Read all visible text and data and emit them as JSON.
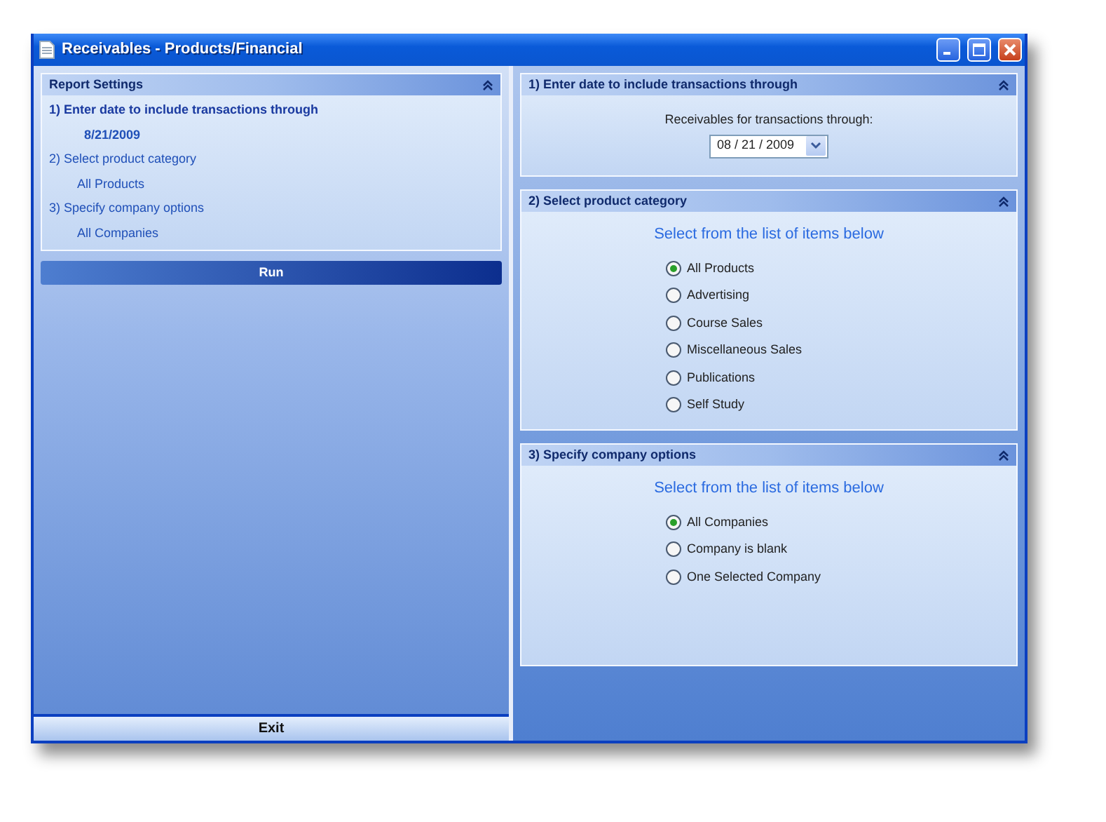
{
  "window": {
    "title": "Receivables - Products/Financial"
  },
  "summary": {
    "title": "Report Settings",
    "steps": [
      {
        "label": "1)  Enter date to include transactions through",
        "value": "8/21/2009",
        "active": true
      },
      {
        "label": "2)  Select product category",
        "value": "All Products",
        "active": false
      },
      {
        "label": "3)  Specify company options",
        "value": "All Companies",
        "active": false
      }
    ]
  },
  "run_button": "Run",
  "exit_button": "Exit",
  "sections": [
    {
      "kind": "date",
      "title": "1)  Enter date to include transactions through",
      "label": "Receivables for transactions through:",
      "value": "08 / 21 / 2009"
    },
    {
      "kind": "radio",
      "title": "2)  Select product category",
      "heading": "Select from the list of items below",
      "options": [
        {
          "label": "All Products",
          "selected": true
        },
        {
          "label": "Advertising",
          "selected": false
        },
        {
          "label": "Course Sales",
          "selected": false
        },
        {
          "label": "Miscellaneous Sales",
          "selected": false
        },
        {
          "label": "Publications",
          "selected": false
        },
        {
          "label": "Self Study",
          "selected": false
        }
      ]
    },
    {
      "kind": "radio",
      "title": "3)  Specify company options",
      "heading": "Select from the list of items below",
      "options": [
        {
          "label": "All Companies",
          "selected": true
        },
        {
          "label": "Company is blank",
          "selected": false
        },
        {
          "label": "One Selected Company",
          "selected": false
        }
      ]
    }
  ]
}
